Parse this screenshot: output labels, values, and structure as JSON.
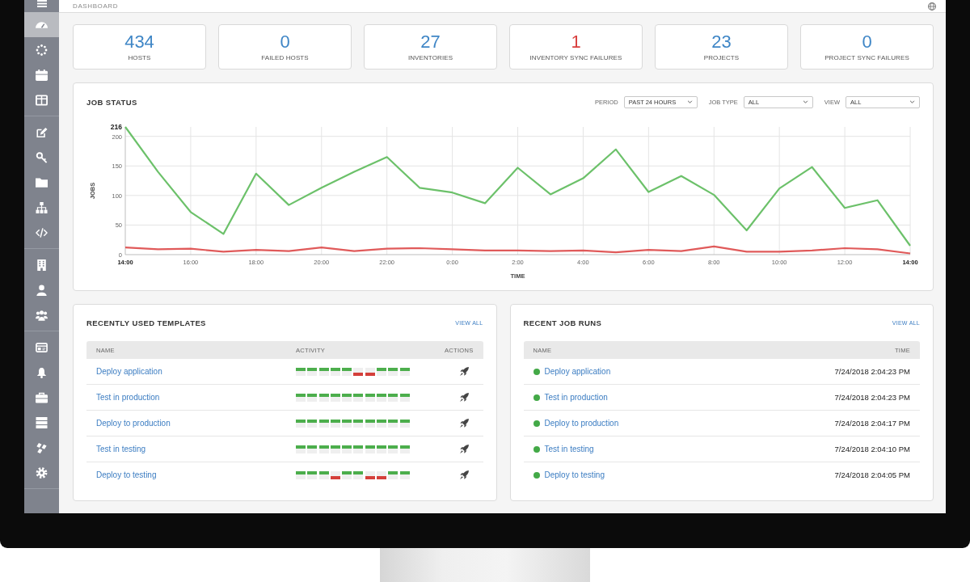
{
  "header": {
    "title": "DASHBOARD"
  },
  "sidebar": {
    "groups": [
      {
        "items": [
          {
            "selected": true
          },
          {
            "selected": false
          },
          {
            "selected": false
          },
          {
            "selected": false
          }
        ]
      },
      {
        "items": [
          {
            "selected": false
          },
          {
            "selected": false
          },
          {
            "selected": false
          },
          {
            "selected": false
          },
          {
            "selected": false
          }
        ]
      },
      {
        "items": [
          {
            "selected": false
          },
          {
            "selected": false
          },
          {
            "selected": false
          }
        ]
      },
      {
        "items": [
          {
            "selected": false
          },
          {
            "selected": false
          },
          {
            "selected": false
          },
          {
            "selected": false
          },
          {
            "selected": false
          },
          {
            "selected": false
          }
        ]
      }
    ]
  },
  "stats": [
    {
      "value": "434",
      "label": "HOSTS",
      "color": "#3f86c6"
    },
    {
      "value": "0",
      "label": "FAILED HOSTS",
      "color": "#3f86c6"
    },
    {
      "value": "27",
      "label": "INVENTORIES",
      "color": "#3f86c6"
    },
    {
      "value": "1",
      "label": "INVENTORY SYNC FAILURES",
      "color": "#d9403f"
    },
    {
      "value": "23",
      "label": "PROJECTS",
      "color": "#3f86c6"
    },
    {
      "value": "0",
      "label": "PROJECT SYNC FAILURES",
      "color": "#3f86c6"
    }
  ],
  "job_status": {
    "filters": [
      {
        "label": "PERIOD",
        "value": "PAST 24 HOURS"
      },
      {
        "label": "JOB TYPE",
        "value": "ALL"
      },
      {
        "label": "VIEW",
        "value": "ALL"
      }
    ],
    "chart_data": {
      "type": "line",
      "title": "JOB STATUS",
      "xlabel": "TIME",
      "ylabel": "JOBS",
      "grid": true,
      "categories": [
        "14:00",
        null,
        "16:00",
        null,
        "18:00",
        null,
        "20:00",
        null,
        "22:00",
        null,
        "0:00",
        null,
        "2:00",
        null,
        "4:00",
        null,
        "6:00",
        null,
        "8:00",
        null,
        "10:00",
        null,
        "12:00",
        null,
        "14:00"
      ],
      "ylim": [
        0,
        216
      ],
      "yticks": [
        0,
        50,
        100,
        150,
        200,
        216
      ],
      "series": [
        {
          "color": "#6cc16a",
          "values": [
            216,
            140,
            72,
            35,
            137,
            84,
            113,
            140,
            165,
            113,
            105,
            87,
            147,
            102,
            129,
            178,
            106,
            133,
            101,
            41,
            112,
            148,
            79,
            92,
            15
          ]
        },
        {
          "color": "#e05a5a",
          "values": [
            12,
            9,
            10,
            5,
            8,
            6,
            12,
            6,
            10,
            11,
            9,
            7,
            7,
            6,
            7,
            4,
            8,
            6,
            14,
            5,
            5,
            7,
            11,
            9,
            2
          ]
        }
      ]
    }
  },
  "templates": {
    "title": "RECENTLY USED TEMPLATES",
    "link": "VIEW ALL",
    "columns": [
      "NAME",
      "ACTIVITY",
      "ACTIONS"
    ],
    "rows": [
      {
        "name": "Deploy application",
        "activity": [
          {
            "failed": false
          },
          {
            "failed": false
          },
          {
            "failed": false
          },
          {
            "failed": false
          },
          {
            "failed": false
          },
          {
            "failed": true
          },
          {
            "failed": true
          },
          {
            "failed": false
          },
          {
            "failed": false
          },
          {
            "failed": false
          }
        ]
      },
      {
        "name": "Test in production",
        "activity": [
          {
            "failed": false
          },
          {
            "failed": false
          },
          {
            "failed": false
          },
          {
            "failed": false
          },
          {
            "failed": false
          },
          {
            "failed": false
          },
          {
            "failed": false
          },
          {
            "failed": false
          },
          {
            "failed": false
          },
          {
            "failed": false
          }
        ]
      },
      {
        "name": "Deploy to production",
        "activity": [
          {
            "failed": false
          },
          {
            "failed": false
          },
          {
            "failed": false
          },
          {
            "failed": false
          },
          {
            "failed": false
          },
          {
            "failed": false
          },
          {
            "failed": false
          },
          {
            "failed": false
          },
          {
            "failed": false
          },
          {
            "failed": false
          }
        ]
      },
      {
        "name": "Test in testing",
        "activity": [
          {
            "failed": false
          },
          {
            "failed": false
          },
          {
            "failed": false
          },
          {
            "failed": false
          },
          {
            "failed": false
          },
          {
            "failed": false
          },
          {
            "failed": false
          },
          {
            "failed": false
          },
          {
            "failed": false
          },
          {
            "failed": false
          }
        ]
      },
      {
        "name": "Deploy to testing",
        "activity": [
          {
            "failed": false
          },
          {
            "failed": false
          },
          {
            "failed": false
          },
          {
            "failed": true
          },
          {
            "failed": false
          },
          {
            "failed": false
          },
          {
            "failed": true
          },
          {
            "failed": true
          },
          {
            "failed": false
          },
          {
            "failed": false
          }
        ]
      }
    ]
  },
  "job_runs": {
    "title": "RECENT JOB RUNS",
    "link": "VIEW ALL",
    "columns": [
      "NAME",
      "TIME"
    ],
    "rows": [
      {
        "name": "Deploy application",
        "time": "7/24/2018 2:04:23 PM",
        "color": "#43a947"
      },
      {
        "name": "Test in production",
        "time": "7/24/2018 2:04:23 PM",
        "color": "#43a947"
      },
      {
        "name": "Deploy to production",
        "time": "7/24/2018 2:04:17 PM",
        "color": "#43a947"
      },
      {
        "name": "Test in testing",
        "time": "7/24/2018 2:04:10 PM",
        "color": "#43a947"
      },
      {
        "name": "Deploy to testing",
        "time": "7/24/2018 2:04:05 PM",
        "color": "#43a947"
      }
    ]
  }
}
